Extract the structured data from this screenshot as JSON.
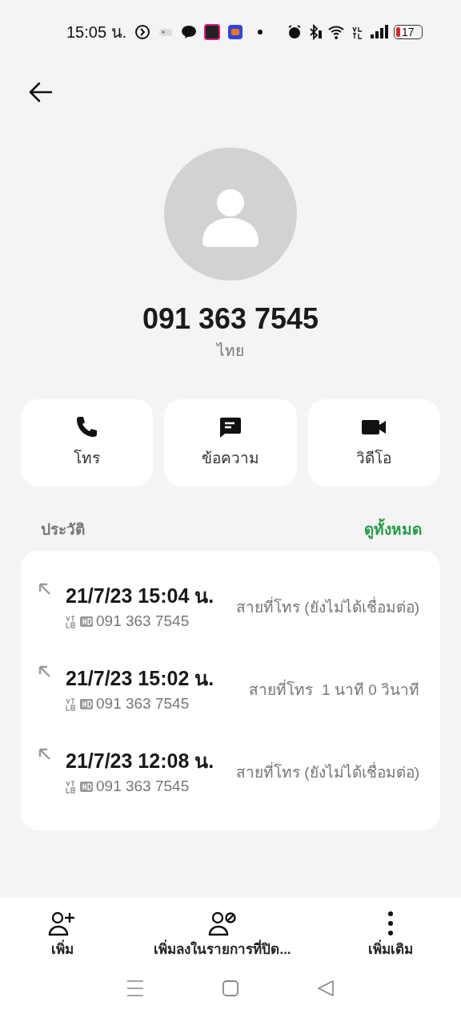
{
  "status_bar": {
    "time": "15:05 น.",
    "battery": "17"
  },
  "contact": {
    "number": "091 363 7545",
    "location": "ไทย"
  },
  "actions": [
    {
      "kind": "call",
      "label": "โทร"
    },
    {
      "kind": "message",
      "label": "ข้อความ"
    },
    {
      "kind": "video",
      "label": "วิดีโอ"
    }
  ],
  "history": {
    "title": "ประวัติ",
    "view_all": "ดูทั้งหมด",
    "calls": [
      {
        "datetime": "21/7/23 15:04 น.",
        "number": "091 363 7545",
        "status": "สายที่โทร (ยังไม่ได้เชื่อมต่อ)"
      },
      {
        "datetime": "21/7/23 15:02 น.",
        "number": "091 363 7545",
        "status": "สายที่โทร  1 นาที 0 วินาที"
      },
      {
        "datetime": "21/7/23 12:08 น.",
        "number": "091 363 7545",
        "status": "สายที่โทร (ยังไม่ได้เชื่อมต่อ)"
      }
    ]
  },
  "bottom_actions": [
    {
      "kind": "add",
      "label": "เพิ่ม"
    },
    {
      "kind": "block",
      "label": "เพิ่มลงในรายการที่ปิด..."
    },
    {
      "kind": "more",
      "label": "เพิ่มเติม"
    }
  ]
}
